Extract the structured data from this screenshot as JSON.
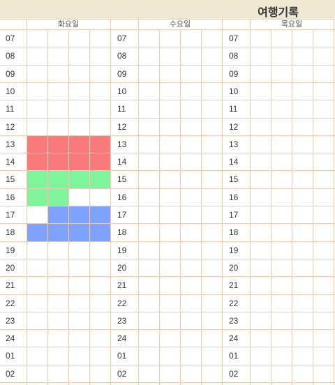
{
  "title": "여행기록",
  "days": [
    "화요일",
    "수요일",
    "목요일"
  ],
  "hours": [
    "07",
    "08",
    "09",
    "10",
    "11",
    "12",
    "13",
    "14",
    "15",
    "16",
    "17",
    "18",
    "19",
    "20",
    "21",
    "22",
    "23",
    "24",
    "01",
    "02"
  ],
  "legend_colors": {
    "red": "#f87a7a",
    "green": "#7ef59a",
    "blue": "#7da2ff"
  },
  "schedule": [
    {
      "day": 0,
      "hour": "13",
      "slots": [
        0,
        1,
        2,
        3
      ],
      "color": "red"
    },
    {
      "day": 0,
      "hour": "14",
      "slots": [
        0,
        1,
        2,
        3
      ],
      "color": "red"
    },
    {
      "day": 0,
      "hour": "15",
      "slots": [
        0,
        1,
        2,
        3
      ],
      "color": "green"
    },
    {
      "day": 0,
      "hour": "16",
      "slots": [
        0,
        1
      ],
      "color": "green"
    },
    {
      "day": 0,
      "hour": "17",
      "slots": [
        1,
        2,
        3
      ],
      "color": "blue"
    },
    {
      "day": 0,
      "hour": "18",
      "slots": [
        0,
        1,
        2,
        3
      ],
      "color": "blue"
    }
  ]
}
